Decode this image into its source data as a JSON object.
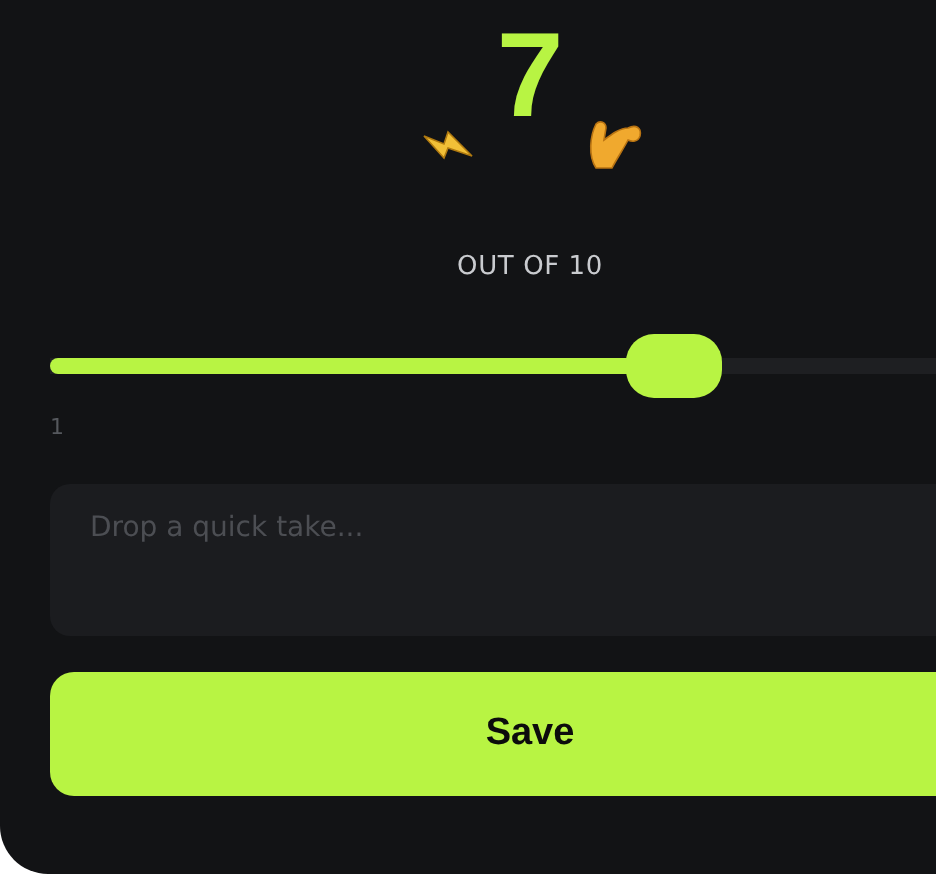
{
  "score": {
    "value": "7",
    "caption": "OUT OF 10"
  },
  "slider": {
    "level": 0.65,
    "min_label": "1"
  },
  "note": {
    "placeholder": "Drop a quick take..."
  },
  "save_button": {
    "label": "Save"
  }
}
